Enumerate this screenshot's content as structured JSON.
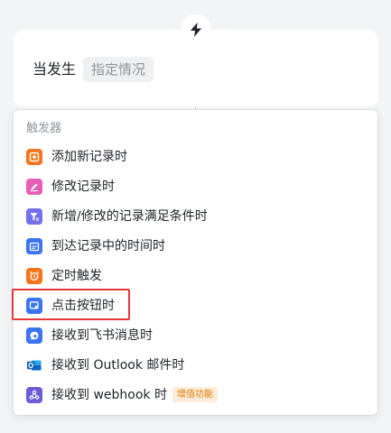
{
  "trigger_card": {
    "when_label": "当发生",
    "condition_placeholder": "指定情况"
  },
  "dropdown": {
    "header": "触发器",
    "items": [
      {
        "label": "添加新记录时",
        "icon": "add-record-icon",
        "color": "#f5751c"
      },
      {
        "label": "修改记录时",
        "icon": "edit-icon",
        "color": "#e65fb7"
      },
      {
        "label": "新增/修改的记录满足条件时",
        "icon": "filter-icon",
        "color": "#7370ee"
      },
      {
        "label": "到达记录中的时间时",
        "icon": "calendar-icon",
        "color": "#3a74f5"
      },
      {
        "label": "定时触发",
        "icon": "alarm-clock-icon",
        "color": "#f5751c"
      },
      {
        "label": "点击按钮时",
        "icon": "click-button-icon",
        "color": "#3a74f5"
      },
      {
        "label": "接收到飞书消息时",
        "icon": "message-icon",
        "color": "#3a74f5"
      },
      {
        "label": "接收到 Outlook 邮件时",
        "icon": "outlook-icon",
        "color": "#1478d4"
      },
      {
        "label": "接收到 webhook 时",
        "icon": "webhook-icon",
        "color": "#6a5bd6",
        "badge": "增值功能"
      }
    ]
  },
  "colors": {
    "highlight": "#e5383b",
    "badge_text": "#de7802",
    "badge_bg": "#fdecd9"
  }
}
